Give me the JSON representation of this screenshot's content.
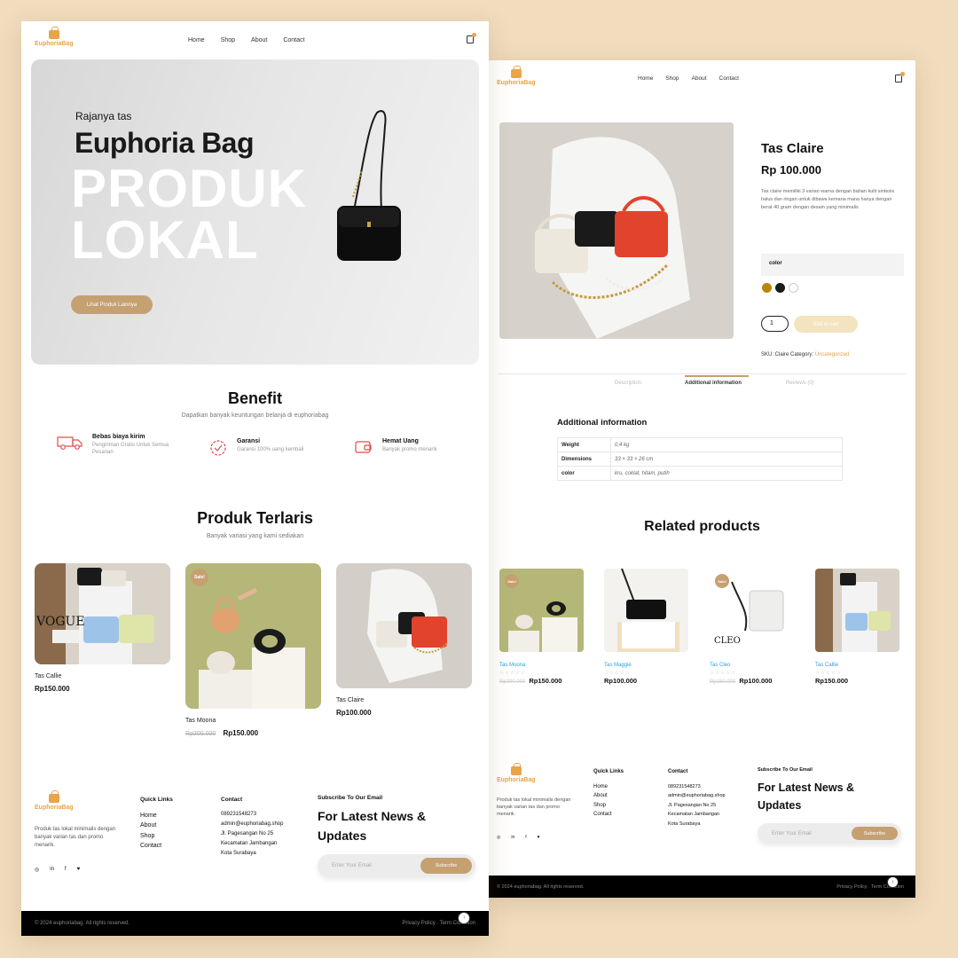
{
  "brand": {
    "name": "EuphoriaBag",
    "accent": "#e9a44a",
    "gold": "#c5a071",
    "background": "#f1dcbd"
  },
  "nav": {
    "items": [
      "Home",
      "Shop",
      "About",
      "Contact"
    ]
  },
  "hero": {
    "subtitle": "Rajanya tas",
    "title": "Euphoria Bag",
    "big_line1": "PRODUK",
    "big_line2": "LOKAL",
    "cta": "Lihat Produk Lainnya"
  },
  "benefit": {
    "title": "Benefit",
    "subtitle": "Dapatkan banyak keuntungan belanja di euphoriabag",
    "items": [
      {
        "title": "Bebas biaya kirim",
        "desc": "Pengiriman Gratis Untuk Semua Pesanan",
        "icon": "truck-icon"
      },
      {
        "title": "Garansi",
        "desc": "Garansi 100% uang kembali",
        "icon": "badge-icon"
      },
      {
        "title": "Hemat Uang",
        "desc": "Banyak promo menarik",
        "icon": "wallet-icon"
      }
    ]
  },
  "bestsellers": {
    "title": "Produk Terlaris",
    "subtitle": "Banyak variasi yang kami sediakan",
    "products": [
      {
        "name": "Tas Callie",
        "price": "Rp150.000",
        "old_price": "",
        "sale": ""
      },
      {
        "name": "Tas Moona",
        "price": "Rp150.000",
        "old_price": "Rp200.000",
        "sale": "Sale!"
      },
      {
        "name": "Tas Claire",
        "price": "Rp100.000",
        "old_price": "",
        "sale": ""
      }
    ]
  },
  "footer": {
    "logo": "EuphoriaBag",
    "desc": "Produk tas lokal minimalis dengan banyak varian tas dan promo menarik.",
    "quick_title": "Quick Links",
    "quick_links": [
      "Home",
      "About",
      "Shop",
      "Contact"
    ],
    "contact_title": "Contact",
    "contact_lines": [
      "089231548273",
      "admin@euphoriabag.shop",
      "Jl. Pagesangan No 25",
      "Kecamatan Jambangan",
      "Kota Surabaya"
    ],
    "subscribe_title": "Subscribe To Our Email",
    "news_line1": "For Latest News &",
    "news_line2": "Updates",
    "email_placeholder": "Enter Your Email",
    "subscribe_btn": "Subscribe",
    "social": [
      "◎",
      "in",
      "f",
      "♥"
    ],
    "copyright": "© 2024 euphoriabag. All rights reserved.",
    "policy": "Privacy Policy . Term Condition",
    "totop": "↑"
  },
  "detail": {
    "name": "Tas Claire",
    "price": "Rp 100.000",
    "desc": "Tas claire memiliki 3 varian warna dengan bahan kulit sintesis halus dan ringan untuk dibawa kemana mana hanya dengan berat 40 gram dengan desain yang minimalis",
    "color_label": "color",
    "swatches": [
      "#b8860b",
      "#1a1a1a",
      "#ffffff"
    ],
    "qty": "1",
    "add_to_cart": "Add to cart",
    "sku_label": "SKU: Claire Category:",
    "category": "Uncategorized",
    "tabs": [
      "Description",
      "Additional information",
      "Reviews (0)"
    ],
    "ai_title": "Additional information",
    "ai_rows": [
      {
        "k": "Weight",
        "v": "0,4 kg"
      },
      {
        "k": "Dimensions",
        "v": "33 × 33 × 26 cm"
      },
      {
        "k": "color",
        "v": "kru, coklat, hitam, putih"
      }
    ],
    "related_title": "Related products",
    "related": [
      {
        "name": "Tas Moona",
        "price": "Rp150.000",
        "old_price": "Rp200.000",
        "sale": "Sale!"
      },
      {
        "name": "Tas Maggie",
        "price": "Rp100.000",
        "old_price": "",
        "sale": ""
      },
      {
        "name": "Tas Cleo",
        "price": "Rp100.000",
        "old_price": "Rp150.000",
        "sale": "Sale!"
      },
      {
        "name": "Tas Callie",
        "price": "Rp150.000",
        "old_price": "",
        "sale": ""
      }
    ],
    "stars": "☆☆☆☆☆",
    "cleo_label": "CLEO"
  }
}
